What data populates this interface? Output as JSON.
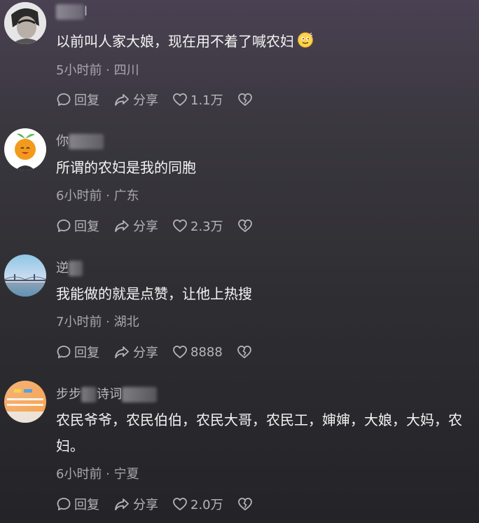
{
  "comments": [
    {
      "username": "l",
      "text": "以前叫人家大娘，现在用不着了喊农妇",
      "meta": "5小时前 · 四川",
      "reply_label": "回复",
      "share_label": "分享",
      "likes": "1.1万"
    },
    {
      "username": "你",
      "text": "所谓的农妇是我的同胞",
      "meta": "6小时前 · 广东",
      "reply_label": "回复",
      "share_label": "分享",
      "likes": "2.3万"
    },
    {
      "username": "逆",
      "text": "我能做的就是点赞，让他上热搜",
      "meta": "7小时前 · 湖北",
      "reply_label": "回复",
      "share_label": "分享",
      "likes": "8888"
    },
    {
      "username_start": "步步",
      "username_mid": "诗词",
      "text": "农民爷爷，农民伯伯，农民大哥，农民工，婶婶，大娘，大妈，农妇。",
      "meta": "6小时前 · 宁夏",
      "reply_label": "回复",
      "share_label": "分享",
      "likes": "2.0万"
    }
  ],
  "icons": {
    "reply": "comment-bubble-icon",
    "share": "share-arrow-icon",
    "like": "heart-outline-icon",
    "dislike": "broken-heart-icon",
    "emoji": "smiling-face-emoji"
  },
  "colors": {
    "text_primary": "#f4f4f4",
    "text_secondary": "#a7a7ad",
    "username": "#b9b9bf"
  }
}
